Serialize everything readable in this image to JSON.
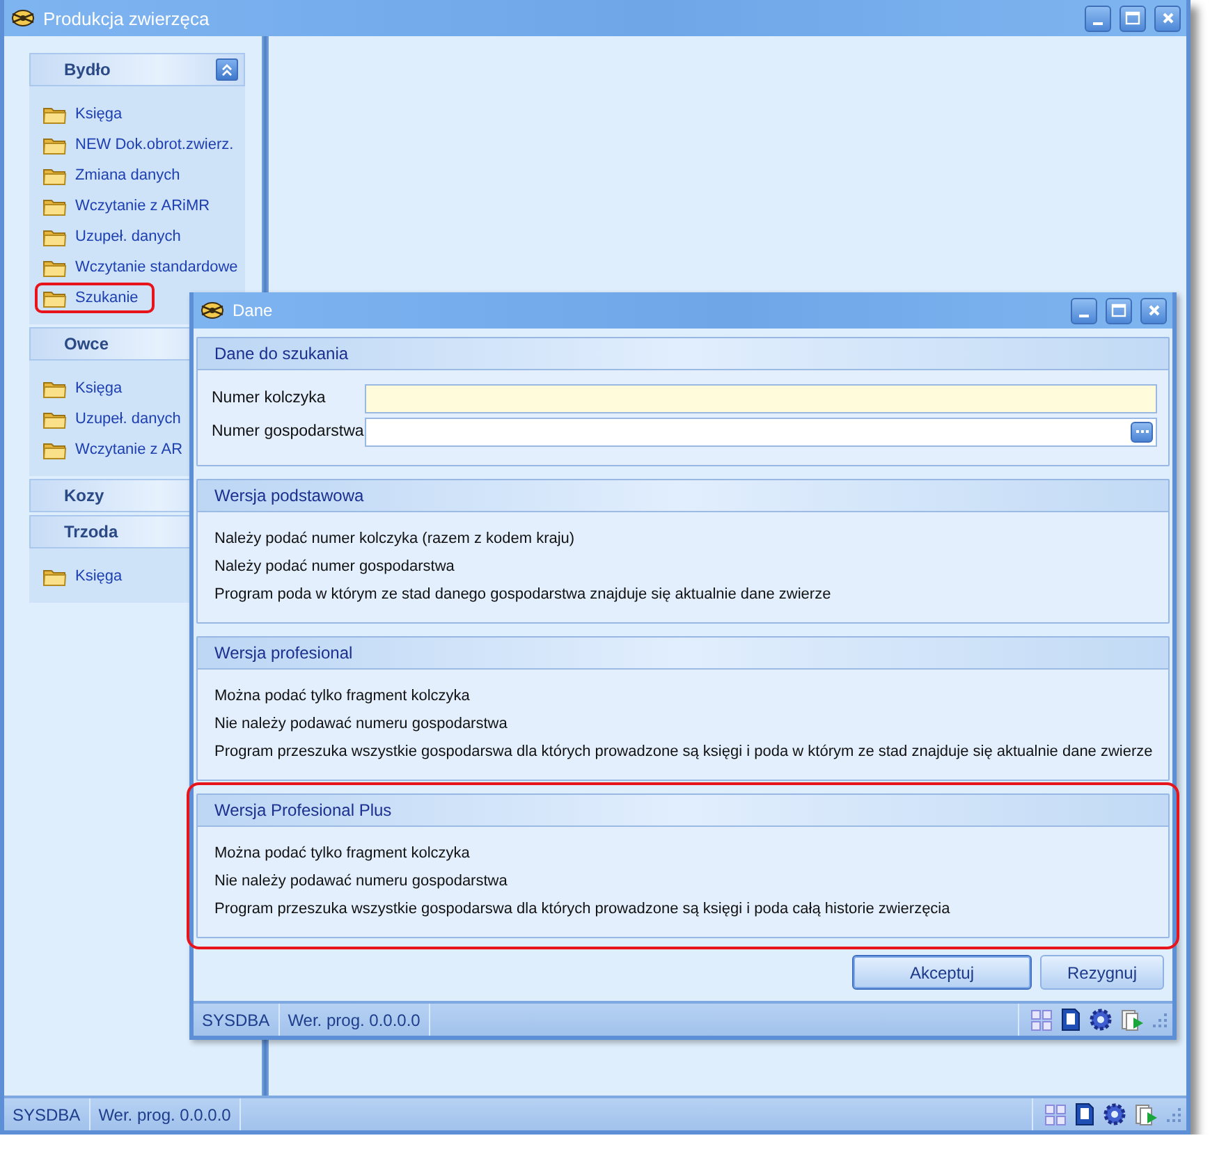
{
  "window": {
    "title": "Produkcja zwierzęca"
  },
  "sidebar": {
    "groups": [
      {
        "title": "Bydło",
        "toggle": true,
        "items": [
          {
            "label": "Księga",
            "highlighted": false
          },
          {
            "label": "NEW Dok.obrot.zwierz.",
            "highlighted": false
          },
          {
            "label": "Zmiana danych",
            "highlighted": false
          },
          {
            "label": "Wczytanie z ARiMR",
            "highlighted": false
          },
          {
            "label": "Uzupeł. danych",
            "highlighted": false
          },
          {
            "label": "Wczytanie standardowe",
            "highlighted": false
          },
          {
            "label": "Szukanie",
            "highlighted": true
          }
        ]
      },
      {
        "title": "Owce",
        "items": [
          {
            "label": "Księga",
            "highlighted": false
          },
          {
            "label": "Uzupeł. danych",
            "highlighted": false
          },
          {
            "label": "Wczytanie z AR",
            "highlighted": false
          }
        ]
      },
      {
        "title": "Kozy"
      },
      {
        "title": "Trzoda",
        "items": [
          {
            "label": "Księga",
            "highlighted": false
          }
        ]
      }
    ]
  },
  "dialog": {
    "title": "Dane",
    "sections": [
      {
        "kind": "fields",
        "title": "Dane do szukania",
        "highlighted": false,
        "fields": [
          {
            "label": "Numer kolczyka",
            "required": true,
            "browse": false
          },
          {
            "label": "Numer gospodarstwa",
            "required": false,
            "browse": true
          }
        ]
      },
      {
        "kind": "text",
        "title": "Wersja podstawowa",
        "highlighted": false,
        "lines": [
          "Należy podać numer kolczyka (razem z kodem kraju)",
          "Należy podać numer gospodarstwa",
          "Program poda w którym ze stad danego gospodarstwa znajduje się aktualnie dane zwierze"
        ]
      },
      {
        "kind": "text",
        "title": "Wersja profesional",
        "highlighted": false,
        "lines": [
          "Można podać tylko fragment kolczyka",
          "Nie należy podawać numeru gospodarstwa",
          "Program przeszuka wszystkie gospodarswa dla których prowadzone są księgi i poda w którym ze stad znajduje się aktualnie dane zwierze"
        ]
      },
      {
        "kind": "text",
        "title": "Wersja Profesional Plus",
        "highlighted": true,
        "lines": [
          "Można podać tylko fragment kolczyka",
          "Nie należy podawać numeru gospodarstwa",
          "Program przeszuka wszystkie gospodarswa dla których prowadzone są księgi i poda całą historie zwierzęcia"
        ]
      }
    ],
    "buttons": [
      {
        "label": "Akceptuj",
        "default": true
      },
      {
        "label": "Rezygnuj",
        "default": false
      }
    ],
    "status_bar": {
      "user": "SYSDBA",
      "version": "Wer. prog. 0.0.0.0"
    }
  },
  "status_bar": {
    "user": "SYSDBA",
    "version": "Wer. prog. 0.0.0.0"
  }
}
